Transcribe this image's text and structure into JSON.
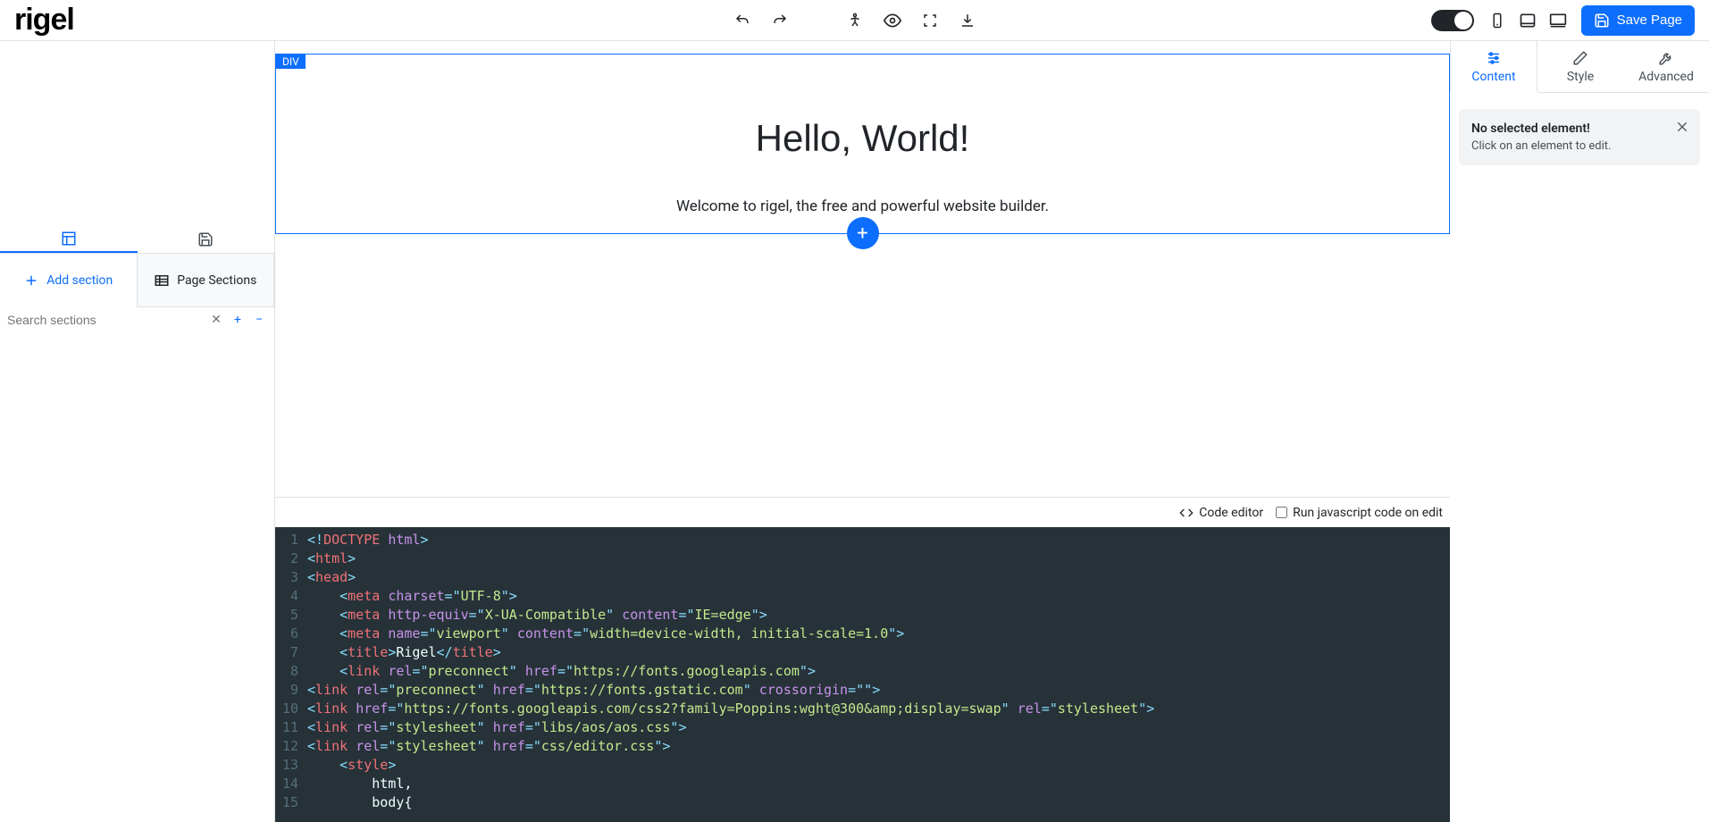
{
  "logo": "rigel",
  "toolbar": {
    "save_label": "Save Page"
  },
  "canvas": {
    "badge": "DIV",
    "heading": "Hello, World!",
    "subheading": "Welcome to rigel, the free and powerful website builder."
  },
  "left": {
    "add_section": "Add section",
    "page_sections": "Page Sections",
    "search_placeholder": "Search sections"
  },
  "code_header": {
    "label": "Code editor",
    "run_js": "Run javascript code on edit"
  },
  "code_lines": [
    [
      {
        "t": "punc",
        "v": "<!"
      },
      {
        "t": "tag",
        "v": "DOCTYPE"
      },
      {
        "t": "text",
        "v": " "
      },
      {
        "t": "attr",
        "v": "html"
      },
      {
        "t": "punc",
        "v": ">"
      }
    ],
    [
      {
        "t": "punc",
        "v": "<"
      },
      {
        "t": "tag",
        "v": "html"
      },
      {
        "t": "punc",
        "v": ">"
      }
    ],
    [
      {
        "t": "punc",
        "v": "<"
      },
      {
        "t": "tag",
        "v": "head"
      },
      {
        "t": "punc",
        "v": ">"
      }
    ],
    [
      {
        "t": "text",
        "v": "    "
      },
      {
        "t": "punc",
        "v": "<"
      },
      {
        "t": "tag",
        "v": "meta"
      },
      {
        "t": "text",
        "v": " "
      },
      {
        "t": "attr",
        "v": "charset"
      },
      {
        "t": "punc",
        "v": "="
      },
      {
        "t": "punc",
        "v": "\""
      },
      {
        "t": "str",
        "v": "UTF-8"
      },
      {
        "t": "punc",
        "v": "\""
      },
      {
        "t": "punc",
        "v": ">"
      }
    ],
    [
      {
        "t": "text",
        "v": "    "
      },
      {
        "t": "punc",
        "v": "<"
      },
      {
        "t": "tag",
        "v": "meta"
      },
      {
        "t": "text",
        "v": " "
      },
      {
        "t": "attr",
        "v": "http-equiv"
      },
      {
        "t": "punc",
        "v": "="
      },
      {
        "t": "punc",
        "v": "\""
      },
      {
        "t": "str",
        "v": "X-UA-Compatible"
      },
      {
        "t": "punc",
        "v": "\""
      },
      {
        "t": "text",
        "v": " "
      },
      {
        "t": "attr",
        "v": "content"
      },
      {
        "t": "punc",
        "v": "="
      },
      {
        "t": "punc",
        "v": "\""
      },
      {
        "t": "str",
        "v": "IE=edge"
      },
      {
        "t": "punc",
        "v": "\""
      },
      {
        "t": "punc",
        "v": ">"
      }
    ],
    [
      {
        "t": "text",
        "v": "    "
      },
      {
        "t": "punc",
        "v": "<"
      },
      {
        "t": "tag",
        "v": "meta"
      },
      {
        "t": "text",
        "v": " "
      },
      {
        "t": "attr",
        "v": "name"
      },
      {
        "t": "punc",
        "v": "="
      },
      {
        "t": "punc",
        "v": "\""
      },
      {
        "t": "str",
        "v": "viewport"
      },
      {
        "t": "punc",
        "v": "\""
      },
      {
        "t": "text",
        "v": " "
      },
      {
        "t": "attr",
        "v": "content"
      },
      {
        "t": "punc",
        "v": "="
      },
      {
        "t": "punc",
        "v": "\""
      },
      {
        "t": "str",
        "v": "width=device-width, initial-scale=1.0"
      },
      {
        "t": "punc",
        "v": "\""
      },
      {
        "t": "punc",
        "v": ">"
      }
    ],
    [
      {
        "t": "text",
        "v": "    "
      },
      {
        "t": "punc",
        "v": "<"
      },
      {
        "t": "tag",
        "v": "title"
      },
      {
        "t": "punc",
        "v": ">"
      },
      {
        "t": "text",
        "v": "Rigel"
      },
      {
        "t": "punc",
        "v": "</"
      },
      {
        "t": "tag",
        "v": "title"
      },
      {
        "t": "punc",
        "v": ">"
      }
    ],
    [
      {
        "t": "text",
        "v": "    "
      },
      {
        "t": "punc",
        "v": "<"
      },
      {
        "t": "tag",
        "v": "link"
      },
      {
        "t": "text",
        "v": " "
      },
      {
        "t": "attr",
        "v": "rel"
      },
      {
        "t": "punc",
        "v": "="
      },
      {
        "t": "punc",
        "v": "\""
      },
      {
        "t": "str",
        "v": "preconnect"
      },
      {
        "t": "punc",
        "v": "\""
      },
      {
        "t": "text",
        "v": " "
      },
      {
        "t": "attr",
        "v": "href"
      },
      {
        "t": "punc",
        "v": "="
      },
      {
        "t": "punc",
        "v": "\""
      },
      {
        "t": "str",
        "v": "https://fonts.googleapis.com"
      },
      {
        "t": "punc",
        "v": "\""
      },
      {
        "t": "punc",
        "v": ">"
      }
    ],
    [
      {
        "t": "punc",
        "v": "<"
      },
      {
        "t": "tag",
        "v": "link"
      },
      {
        "t": "text",
        "v": " "
      },
      {
        "t": "attr",
        "v": "rel"
      },
      {
        "t": "punc",
        "v": "="
      },
      {
        "t": "punc",
        "v": "\""
      },
      {
        "t": "str",
        "v": "preconnect"
      },
      {
        "t": "punc",
        "v": "\""
      },
      {
        "t": "text",
        "v": " "
      },
      {
        "t": "attr",
        "v": "href"
      },
      {
        "t": "punc",
        "v": "="
      },
      {
        "t": "punc",
        "v": "\""
      },
      {
        "t": "str",
        "v": "https://fonts.gstatic.com"
      },
      {
        "t": "punc",
        "v": "\""
      },
      {
        "t": "text",
        "v": " "
      },
      {
        "t": "attr",
        "v": "crossorigin"
      },
      {
        "t": "punc",
        "v": "="
      },
      {
        "t": "punc",
        "v": "\""
      },
      {
        "t": "punc",
        "v": "\""
      },
      {
        "t": "punc",
        "v": ">"
      }
    ],
    [
      {
        "t": "punc",
        "v": "<"
      },
      {
        "t": "tag",
        "v": "link"
      },
      {
        "t": "text",
        "v": " "
      },
      {
        "t": "attr",
        "v": "href"
      },
      {
        "t": "punc",
        "v": "="
      },
      {
        "t": "punc",
        "v": "\""
      },
      {
        "t": "str",
        "v": "https://fonts.googleapis.com/css2?family=Poppins:wght@300&amp;display=swap"
      },
      {
        "t": "punc",
        "v": "\""
      },
      {
        "t": "text",
        "v": " "
      },
      {
        "t": "attr",
        "v": "rel"
      },
      {
        "t": "punc",
        "v": "="
      },
      {
        "t": "punc",
        "v": "\""
      },
      {
        "t": "str",
        "v": "stylesheet"
      },
      {
        "t": "punc",
        "v": "\""
      },
      {
        "t": "punc",
        "v": ">"
      }
    ],
    [
      {
        "t": "punc",
        "v": "<"
      },
      {
        "t": "tag",
        "v": "link"
      },
      {
        "t": "text",
        "v": " "
      },
      {
        "t": "attr",
        "v": "rel"
      },
      {
        "t": "punc",
        "v": "="
      },
      {
        "t": "punc",
        "v": "\""
      },
      {
        "t": "str",
        "v": "stylesheet"
      },
      {
        "t": "punc",
        "v": "\""
      },
      {
        "t": "text",
        "v": " "
      },
      {
        "t": "attr",
        "v": "href"
      },
      {
        "t": "punc",
        "v": "="
      },
      {
        "t": "punc",
        "v": "\""
      },
      {
        "t": "str",
        "v": "libs/aos/aos.css"
      },
      {
        "t": "punc",
        "v": "\""
      },
      {
        "t": "punc",
        "v": ">"
      }
    ],
    [
      {
        "t": "punc",
        "v": "<"
      },
      {
        "t": "tag",
        "v": "link"
      },
      {
        "t": "text",
        "v": " "
      },
      {
        "t": "attr",
        "v": "rel"
      },
      {
        "t": "punc",
        "v": "="
      },
      {
        "t": "punc",
        "v": "\""
      },
      {
        "t": "str",
        "v": "stylesheet"
      },
      {
        "t": "punc",
        "v": "\""
      },
      {
        "t": "text",
        "v": " "
      },
      {
        "t": "attr",
        "v": "href"
      },
      {
        "t": "punc",
        "v": "="
      },
      {
        "t": "punc",
        "v": "\""
      },
      {
        "t": "str",
        "v": "css/editor.css"
      },
      {
        "t": "punc",
        "v": "\""
      },
      {
        "t": "punc",
        "v": ">"
      }
    ],
    [
      {
        "t": "text",
        "v": "    "
      },
      {
        "t": "punc",
        "v": "<"
      },
      {
        "t": "tag",
        "v": "style"
      },
      {
        "t": "punc",
        "v": ">"
      }
    ],
    [
      {
        "t": "text",
        "v": "        html,"
      }
    ],
    [
      {
        "t": "text",
        "v": "        body{"
      }
    ]
  ],
  "right": {
    "tabs": {
      "content": "Content",
      "style": "Style",
      "advanced": "Advanced"
    },
    "info_title": "No selected element!",
    "info_text": "Click on an element to edit."
  }
}
